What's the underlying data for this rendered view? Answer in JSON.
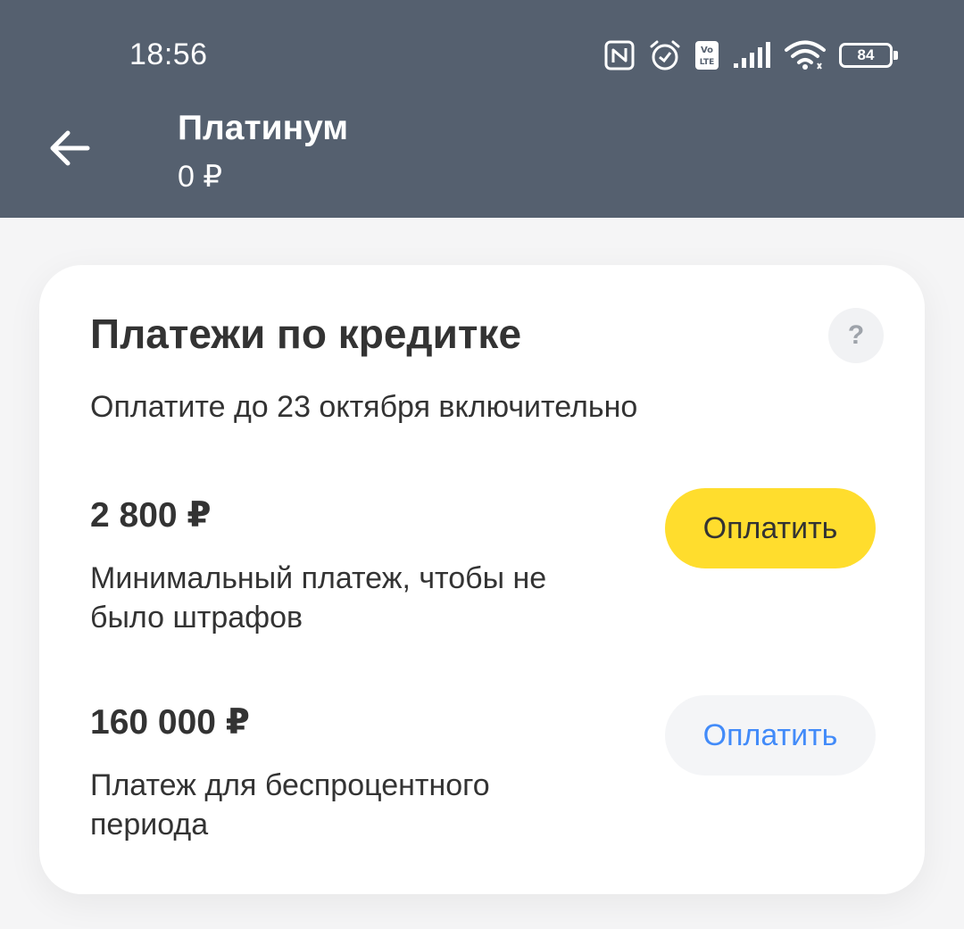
{
  "status_bar": {
    "time": "18:56",
    "battery": "84",
    "icons": [
      "nfc-icon",
      "alarm-icon",
      "volte-icon",
      "signal-icon",
      "wifi-icon",
      "battery-icon"
    ]
  },
  "header": {
    "back_icon": "arrow-left-icon",
    "title": "Платинум",
    "balance": "0 ₽"
  },
  "card": {
    "title": "Платежи по кредитке",
    "help_label": "?",
    "subtitle": "Оплатите до 23 октября включительно",
    "payments": [
      {
        "amount": "2 800 ₽",
        "description": "Минимальный платеж, чтобы не было штрафов",
        "button_label": "Оплатить"
      },
      {
        "amount": "160 000 ₽",
        "description": "Платеж для беспроцентного периода",
        "button_label": "Оплатить"
      }
    ]
  },
  "colors": {
    "header_bg": "#55606f",
    "primary_button": "#ffdd2d",
    "secondary_button_text": "#428bf9",
    "text": "#333333"
  }
}
